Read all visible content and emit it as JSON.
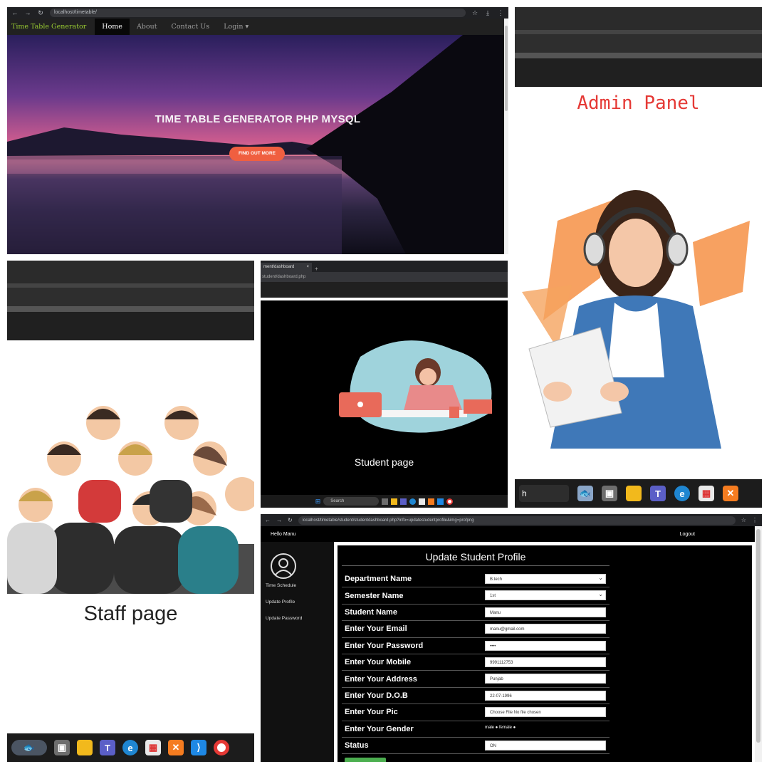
{
  "home": {
    "url": "localhost/timetable/",
    "brand": "Time Table Generator",
    "nav": [
      "Home",
      "About",
      "Contact Us",
      "Login ▾"
    ],
    "headline": "TIME TABLE GENERATOR PHP MYSQL",
    "cta": "FIND OUT MORE",
    "accent": "#f05f40"
  },
  "admin": {
    "title": "Admin Panel",
    "taskbar_search": "h",
    "taskbar_icons": [
      "fish-widget-icon",
      "task-view-icon",
      "file-explorer-icon",
      "teams-icon",
      "edge-icon",
      "store-icon",
      "xampp-icon"
    ],
    "title_color": "#e53935"
  },
  "staff": {
    "title": "Staff page",
    "taskbar_icons": [
      "fish-widget-icon",
      "task-view-icon",
      "file-explorer-icon",
      "teams-icon",
      "edge-icon",
      "store-icon",
      "xampp-icon",
      "vscode-icon",
      "chrome-icon"
    ]
  },
  "student": {
    "tab_label": "ment/dashboard",
    "address": "student/dashboard.php",
    "title": "Student page",
    "taskbar_search": "Search"
  },
  "profile": {
    "url": "localhost/timetable/student/studentdashboard.php?info=updatestudentprofile&img=profpng",
    "greeting": "Hello Manu",
    "logout": "Logout",
    "sidebar": [
      "Time Schedule",
      "Update Profile",
      "Update Password"
    ],
    "form_title": "Update Student Profile",
    "fields": [
      {
        "label": "Department Name",
        "value": "B.tech",
        "kind": "select"
      },
      {
        "label": "Semester Name",
        "value": "1st",
        "kind": "select"
      },
      {
        "label": "Student Name",
        "value": "Manu",
        "kind": "text"
      },
      {
        "label": "Enter Your Email",
        "value": "manu@gmail.com",
        "kind": "text"
      },
      {
        "label": "Enter Your Password",
        "value": "••••",
        "kind": "password"
      },
      {
        "label": "Enter Your Mobile",
        "value": "9991112753",
        "kind": "text"
      },
      {
        "label": "Enter Your Address",
        "value": "Punjab",
        "kind": "text"
      },
      {
        "label": "Enter Your D.O.B",
        "value": "22-07-1996",
        "kind": "date"
      },
      {
        "label": "Enter Your Pic",
        "value": "Choose File  No file chosen",
        "kind": "file"
      },
      {
        "label": "Enter Your Gender",
        "value": "male ● female ●",
        "kind": "radio"
      },
      {
        "label": "Status",
        "value": "ON",
        "kind": "text"
      }
    ]
  }
}
